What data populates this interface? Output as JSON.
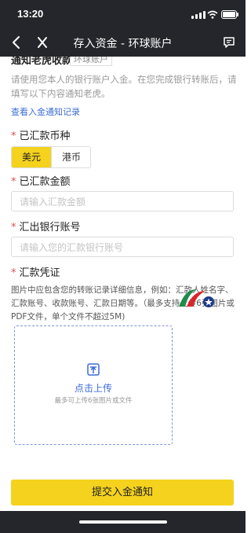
{
  "status_bar": {
    "time": "13:20"
  },
  "nav": {
    "title": "存入资金 - 环球账户"
  },
  "top_section": {
    "title": "通知老虎收款",
    "tag": "环球账户",
    "notice": "请使用您本人的银行账户入金。在您完成银行转账后，请填写以下内容通知老虎。",
    "link": "查看入金通知记录"
  },
  "currency": {
    "required_mark": "*",
    "label": "已汇款币种",
    "options": [
      "美元",
      "港币"
    ],
    "selected": "美元"
  },
  "amount": {
    "required_mark": "*",
    "label": "已汇款金额",
    "placeholder": "请输入汇款金额",
    "value": ""
  },
  "bank_account": {
    "required_mark": "*",
    "label": "汇出银行账号",
    "placeholder": "请输入您的汇款银行账号",
    "value": ""
  },
  "voucher": {
    "required_mark": "*",
    "label": "汇款凭证",
    "description": "图片中应包含您的转账记录详细信息，例如：汇款人姓名字、汇款账号、收款账号、汇款日期等。（最多支持上传6张图片或PDF文件，单个文件不超过5M)",
    "upload_label": "点击上传",
    "upload_sub": "最多可上传6张图片或文件"
  },
  "submit": {
    "label": "提交入金通知"
  },
  "colors": {
    "accent": "#f5d21e",
    "link": "#3b6cd8",
    "required": "#e34f4f",
    "bar": "#25262b"
  }
}
